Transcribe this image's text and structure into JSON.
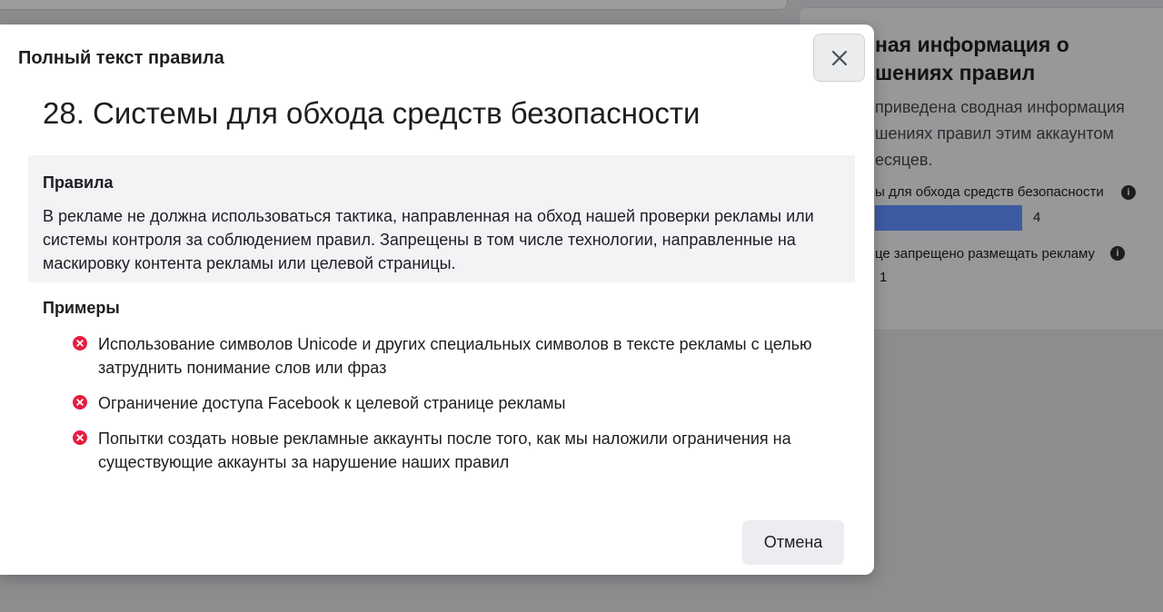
{
  "background": {
    "panel_title": "ная информация о\nшениях правил",
    "panel_desc": "приведена сводная информация\nшениях правил этим аккаунтом\nесяцев.",
    "rows": [
      {
        "label": "ы для обхода средств безопасности",
        "count": "4"
      },
      {
        "label": "це запрещено размещать рекламу",
        "count": "1"
      }
    ],
    "bar_color": "#3d5ba3"
  },
  "modal": {
    "header_title": "Полный текст правила",
    "rule_title": "28. Системы для обхода средств безопасности",
    "rules_heading": "Правила",
    "rules_lines": [
      "В рекламе не должна использоваться тактика, направленная на обход нашей проверки рекламы или",
      "системы контроля за соблюдением правил. Запрещены в том числе технологии, направленные на",
      "маскировку контента рекламы или целевой страницы."
    ],
    "examples_heading": "Примеры",
    "examples": [
      {
        "lines": [
          "Использование символов Unicode и других специальных символов в тексте рекламы с целью",
          "затруднить понимание слов или фраз"
        ]
      },
      {
        "lines": [
          "Ограничение доступа Facebook к целевой странице рекламы"
        ]
      },
      {
        "lines": [
          "Попытки создать новые рекламные аккаунты после того, как мы наложили ограничения на",
          "существующие аккаунты за нарушение наших правил"
        ]
      }
    ],
    "example_icon": "x-circle-icon",
    "example_icon_color": "#e41e3f",
    "cancel_label": "Отмена",
    "close_icon": "close-icon"
  }
}
